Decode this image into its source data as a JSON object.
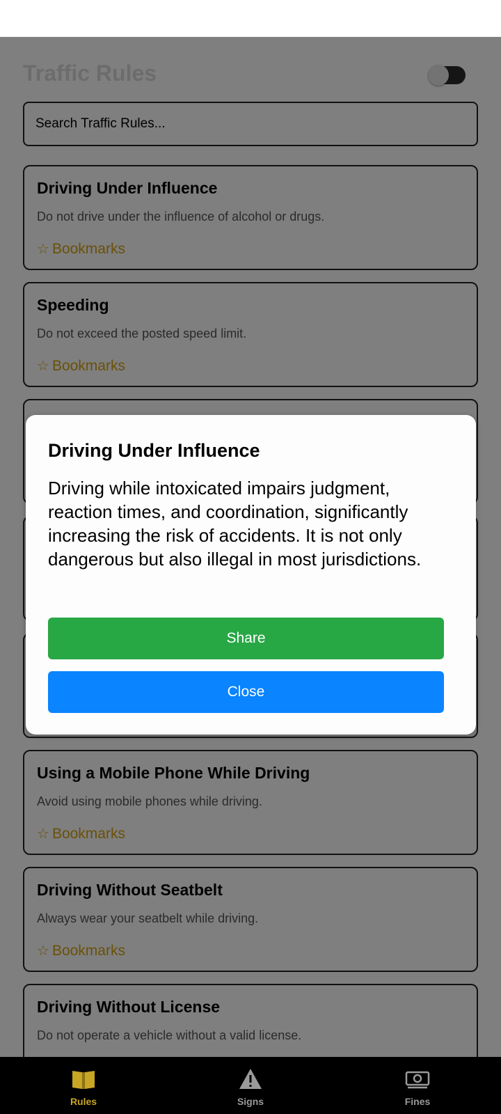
{
  "header": {
    "title": "Traffic Rules"
  },
  "search": {
    "placeholder": "Search Traffic Rules..."
  },
  "rules": [
    {
      "title": "Driving Under Influence",
      "desc": "Do not drive under the influence of alcohol or drugs.",
      "bookmark": "Bookmarks"
    },
    {
      "title": "Speeding",
      "desc": "Do not exceed the posted speed limit.",
      "bookmark": "Bookmarks"
    },
    {
      "title": "Using a Mobile Phone While Driving",
      "desc": "Avoid using mobile phones while driving.",
      "bookmark": "Bookmarks"
    },
    {
      "title": "Driving Without Seatbelt",
      "desc": "Always wear your seatbelt while driving.",
      "bookmark": "Bookmarks"
    },
    {
      "title": "Driving Without License",
      "desc": "Do not operate a vehicle without a valid license.",
      "bookmark": "Bookmarks"
    }
  ],
  "modal": {
    "title": "Driving Under Influence",
    "body": "Driving while intoxicated impairs judgment, reaction times, and coordination, significantly increasing the risk of accidents. It is not only dangerous but also illegal in most jurisdictions.",
    "share_label": "Share",
    "close_label": "Close"
  },
  "tabs": [
    {
      "label": "Rules",
      "icon": "book-icon",
      "active": true
    },
    {
      "label": "Signs",
      "icon": "warning-icon",
      "active": false
    },
    {
      "label": "Fines",
      "icon": "money-icon",
      "active": false
    }
  ],
  "colors": {
    "accent_active_tab": "#c8a624",
    "inactive_tab": "#9a9a9a",
    "bookmark": "#d4a010",
    "share_button": "#28a745",
    "close_button": "#0a84ff"
  }
}
